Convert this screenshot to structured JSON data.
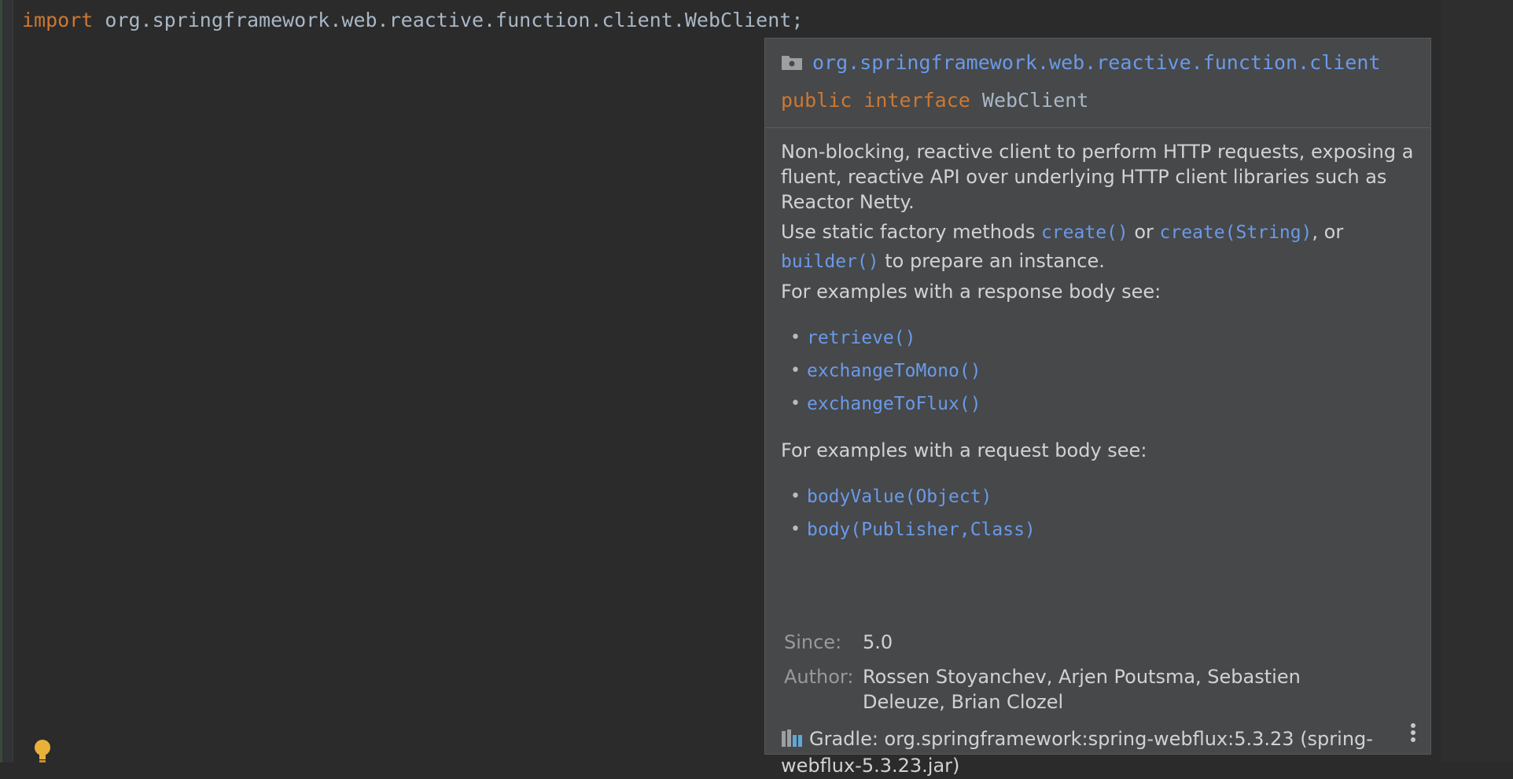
{
  "editor": {
    "import_keyword": "import",
    "import_path": " org.springframework.web.reactive.function.client.WebClient;",
    "gutter_icon": "lightbulb-icon"
  },
  "popup": {
    "package_icon": "package-folder-icon",
    "package_name": "org.springframework.web.reactive.function.client",
    "signature": {
      "modifier": "public",
      "keyword": "interface",
      "name": "WebClient"
    },
    "description_1": "Non-blocking, reactive client to perform HTTP requests, exposing a fluent, reactive API over underlying HTTP client libraries such as Reactor Netty.",
    "factory_text": {
      "prefix": "Use static factory methods ",
      "link1": "create()",
      "mid1": " or ",
      "link2": "create(String)",
      "mid2": ", or ",
      "link3": "builder()",
      "suffix": " to prepare an instance."
    },
    "response_heading": "For examples with a response body see:",
    "response_links": [
      "retrieve()",
      "exchangeToMono()",
      "exchangeToFlux()"
    ],
    "request_heading": "For examples with a request body see:",
    "request_links": [
      "bodyValue(Object)",
      "body(Publisher,Class)"
    ],
    "since_label": "Since:",
    "since_value": "5.0",
    "author_label": "Author:",
    "author_value": "Rossen Stoyanchev, Arjen Poutsma, Sebastien Deleuze, Brian Clozel",
    "gradle_icon": "library-icon",
    "gradle_text": "Gradle: org.springframework:spring-webflux:5.3.23 (spring-webflux-5.3.23.jar)",
    "more_icon": "more-vertical-icon"
  },
  "colors": {
    "link": "#6b9ae8",
    "keyword": "#cc7832",
    "text": "#d2d2d2",
    "popup_bg": "#46484a",
    "editor_bg": "#2b2b2b"
  }
}
